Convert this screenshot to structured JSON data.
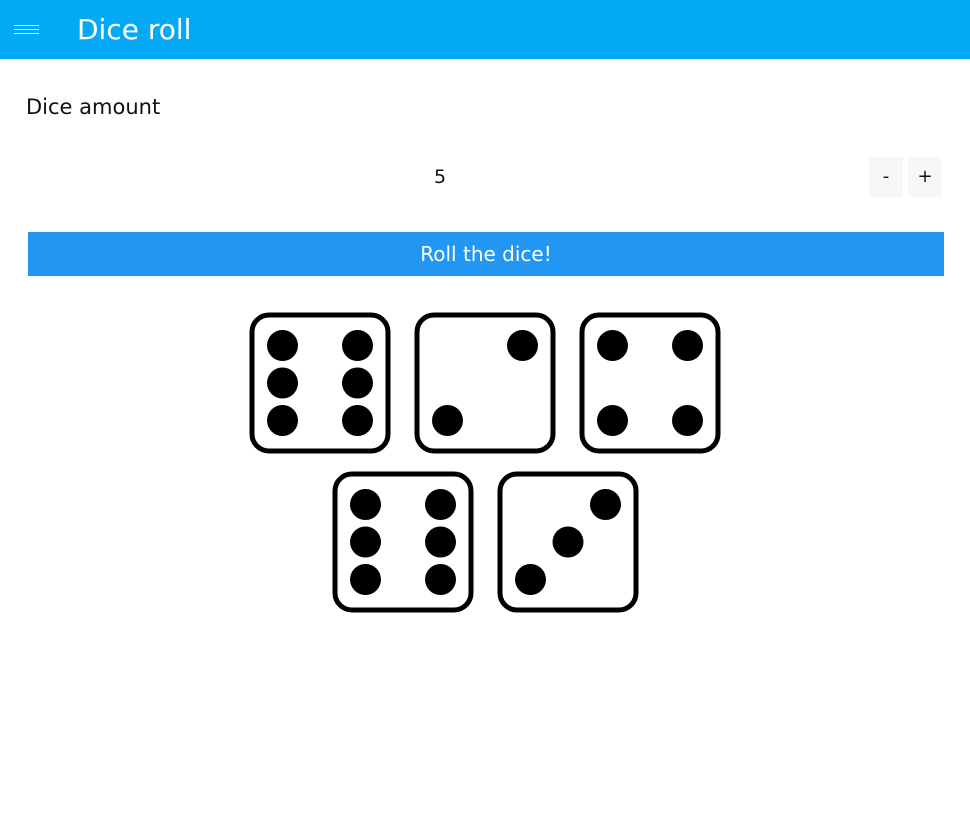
{
  "header": {
    "menu_icon": "hamburger-icon",
    "title": "Dice roll",
    "bar_color": "#03a9f4"
  },
  "dice_amount": {
    "label": "Dice amount",
    "value": "5",
    "decrement_label": "-",
    "increment_label": "+"
  },
  "roll": {
    "label": "Roll the dice!",
    "button_color": "#2196f3"
  },
  "dice_results": [
    6,
    2,
    4,
    6,
    3
  ]
}
